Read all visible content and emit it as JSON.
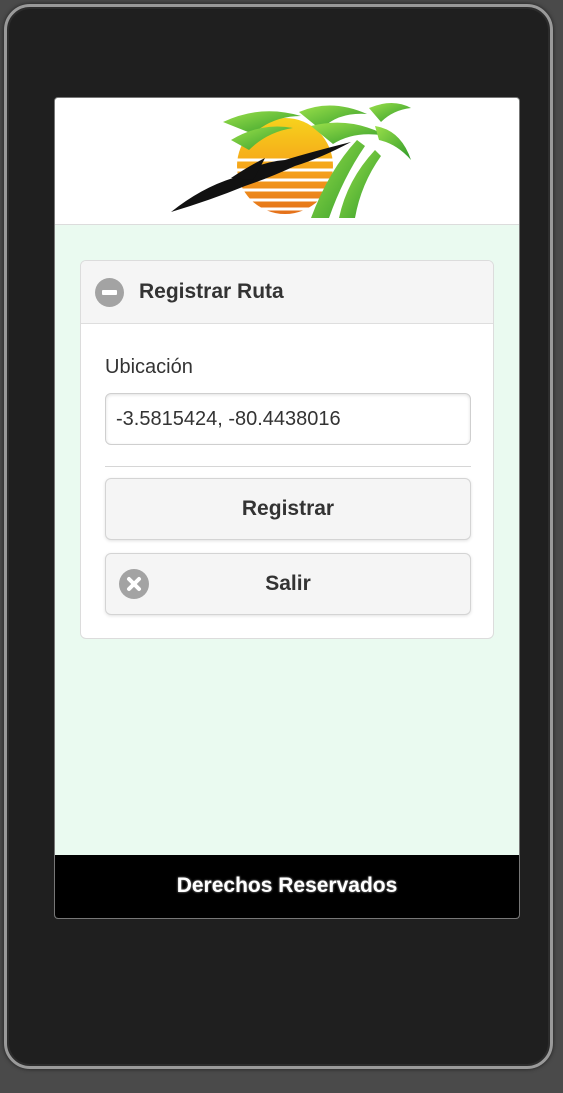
{
  "panel": {
    "title": "Registrar Ruta",
    "expanded": true,
    "icon": "minus-circle-icon"
  },
  "form": {
    "location_label": "Ubicación",
    "location_value": "-3.5815424, -80.4438016"
  },
  "buttons": {
    "register_label": "Registrar",
    "exit_label": "Salir",
    "exit_icon": "close-circle-icon"
  },
  "footer": {
    "text": "Derechos Reservados"
  },
  "colors": {
    "content_background": "#eafaf0",
    "footer_background": "#000000",
    "button_background": "#f5f5f5",
    "icon_gray": "#a3a3a3"
  }
}
